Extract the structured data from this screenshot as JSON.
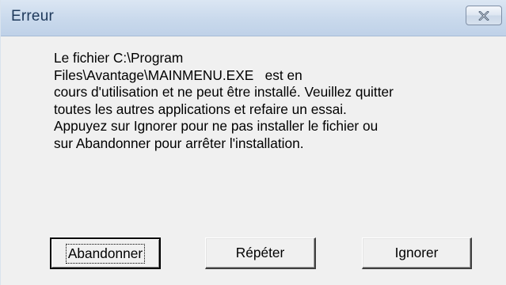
{
  "window": {
    "title": "Erreur",
    "close_icon": "close-x-icon"
  },
  "message": {
    "lines": [
      "Le fichier C:\\Program",
      "Files\\Avantage\\MAINMENU.EXE   est en",
      "cours d'utilisation et ne peut être installé. Veuillez quitter",
      "toutes les autres applications et refaire un essai.",
      "Appuyez sur Ignorer pour ne pas installer le fichier ou",
      "sur Abandonner pour arrêter l'installation."
    ]
  },
  "buttons": {
    "abandon_label": "Abandonner",
    "retry_label": "Répéter",
    "ignore_label": "Ignorer"
  },
  "colors": {
    "titlebar": "#c9d9ec",
    "title_text": "#1e395b",
    "dialog_bg": "#f0f0f0"
  }
}
